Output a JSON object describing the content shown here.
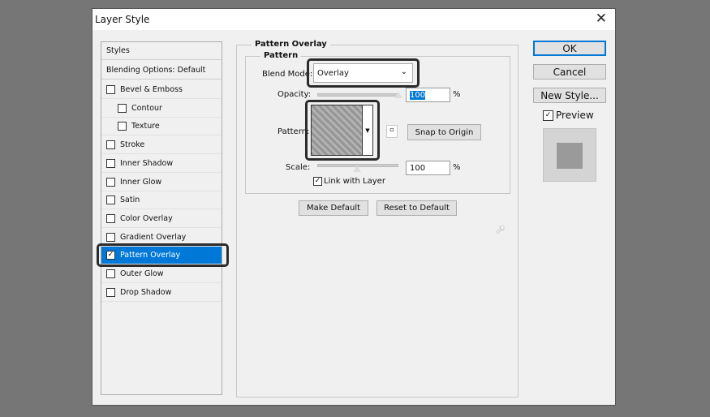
{
  "window": {
    "title": "Layer Style",
    "close": "✕"
  },
  "sidebar": {
    "items": [
      {
        "label": "Styles",
        "type": "header"
      },
      {
        "label": "Blending Options: Default",
        "type": "header"
      },
      {
        "label": "Bevel & Emboss",
        "checked": false
      },
      {
        "label": "Contour",
        "checked": false,
        "indent": true
      },
      {
        "label": "Texture",
        "checked": false,
        "indent": true
      },
      {
        "label": "Stroke",
        "checked": false
      },
      {
        "label": "Inner Shadow",
        "checked": false
      },
      {
        "label": "Inner Glow",
        "checked": false
      },
      {
        "label": "Satin",
        "checked": false
      },
      {
        "label": "Color Overlay",
        "checked": false
      },
      {
        "label": "Gradient Overlay",
        "checked": false
      },
      {
        "label": "Pattern Overlay",
        "checked": true,
        "selected": true
      },
      {
        "label": "Outer Glow",
        "checked": false
      },
      {
        "label": "Drop Shadow",
        "checked": false
      }
    ]
  },
  "main": {
    "group_title": "Pattern Overlay",
    "subgroup_title": "Pattern",
    "blend_mode_label": "Blend Mode:",
    "blend_mode_value": "Overlay",
    "opacity_label": "Opacity:",
    "opacity_value": "100",
    "opacity_fraction": 1.0,
    "percent": "%",
    "pattern_label": "Pattern:",
    "snap_label": "Snap to Origin",
    "scale_label": "Scale:",
    "scale_value": "100",
    "link_label": "Link with Layer",
    "link_checked": true,
    "make_default": "Make Default",
    "reset_default": "Reset to Default"
  },
  "right": {
    "ok": "OK",
    "cancel": "Cancel",
    "new_style": "New Style...",
    "preview_label": "Preview",
    "preview_checked": true
  },
  "colors": {
    "selection": "#0078d7",
    "highlight_outline": "#2b2b2b"
  }
}
